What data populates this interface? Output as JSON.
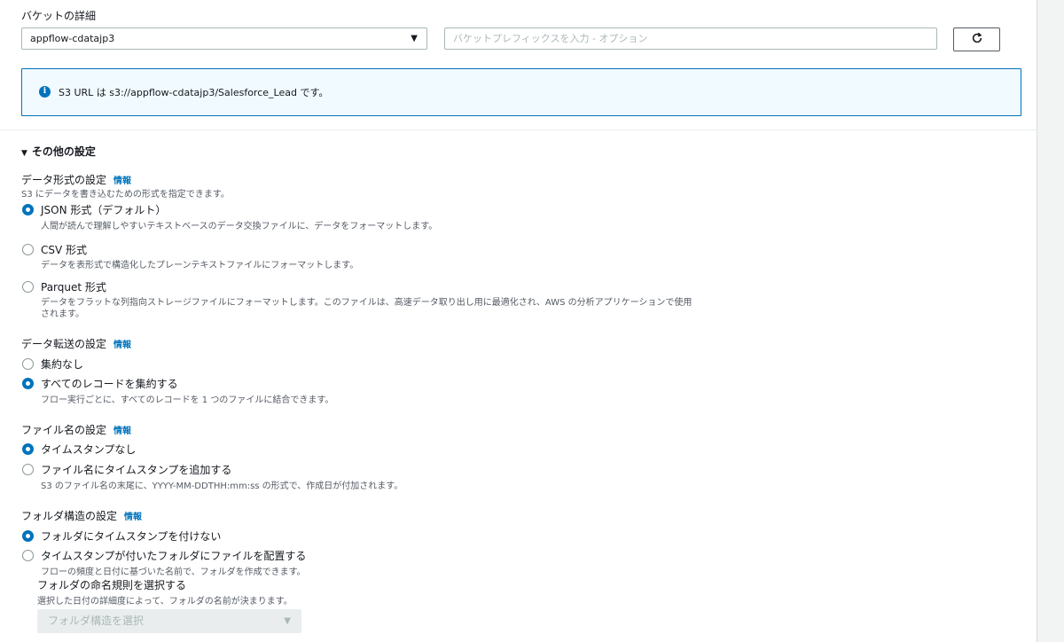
{
  "bucket": {
    "section_label": "バケットの詳細",
    "selected_bucket": "appflow-cdatajp3",
    "prefix_placeholder": "バケットプレフィックスを入力 - オプション",
    "refresh_icon": "refresh-icon"
  },
  "alert": {
    "icon": "info-icon",
    "text": "S3 URL は s3://appflow-cdatajp3/Salesforce_Lead です。"
  },
  "other_settings": {
    "toggle_label": "その他の設定"
  },
  "data_format": {
    "title": "データ形式の設定",
    "info": "情報",
    "description": "S3 にデータを書き込むための形式を指定できます。",
    "options": [
      {
        "label": "JSON 形式（デフォルト）",
        "desc": "人間が読んで理解しやすいテキストベースのデータ交換ファイルに、データをフォーマットします。",
        "selected": true
      },
      {
        "label": "CSV 形式",
        "desc": "データを表形式で構造化したプレーンテキストファイルにフォーマットします。",
        "selected": false
      },
      {
        "label": "Parquet 形式",
        "desc": "データをフラットな列指向ストレージファイルにフォーマットします。このファイルは、高速データ取り出し用に最適化され、AWS の分析アプリケーションで使用",
        "desc2": "されます。",
        "selected": false
      }
    ]
  },
  "transfer": {
    "title": "データ転送の設定",
    "info": "情報",
    "options": [
      {
        "label": "集約なし",
        "selected": false
      },
      {
        "label": "すべてのレコードを集約する",
        "desc": "フロー実行ごとに、すべてのレコードを 1 つのファイルに結合できます。",
        "selected": true
      }
    ]
  },
  "filename": {
    "title": "ファイル名の設定",
    "info": "情報",
    "options": [
      {
        "label": "タイムスタンプなし",
        "selected": true
      },
      {
        "label": "ファイル名にタイムスタンプを追加する",
        "desc": "S3 のファイル名の末尾に、YYYY-MM-DDTHH:mm:ss の形式で、作成日が付加されます。",
        "selected": false
      }
    ]
  },
  "folder": {
    "title": "フォルダ構造の設定",
    "info": "情報",
    "options": [
      {
        "label": "フォルダにタイムスタンプを付けない",
        "selected": true
      },
      {
        "label": "タイムスタンプが付いたフォルダにファイルを配置する",
        "desc": "フローの頻度と日付に基づいた名前で、フォルダを作成できます。",
        "selected": false
      }
    ],
    "naming_title": "フォルダの命名規則を選択する",
    "naming_desc": "選択した日付の詳細度によって、フォルダの名前が決まります。",
    "naming_placeholder": "フォルダ構造を選択"
  }
}
